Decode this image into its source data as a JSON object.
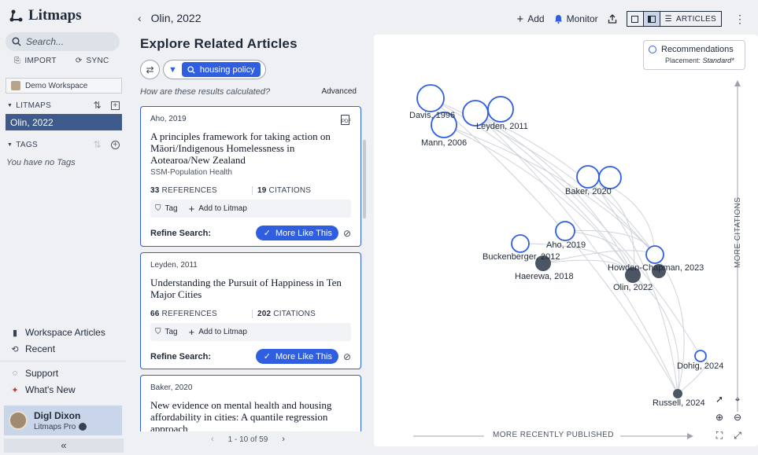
{
  "app": {
    "name": "Litmaps",
    "search_placeholder": "Search...",
    "import_label": "IMPORT",
    "sync_label": "SYNC",
    "workspace": "Demo Workspace",
    "litmaps_header": "LITMAPS",
    "selected_litmap": "Olin, 2022",
    "tags_header": "TAGS",
    "no_tags": "You have no Tags",
    "workspace_articles": "Workspace Articles",
    "recent": "Recent",
    "support": "Support",
    "whats_new": "What's New",
    "user_name": "Digl Dixon",
    "user_plan": "Litmaps Pro"
  },
  "topbar": {
    "title": "Olin, 2022",
    "add": "Add",
    "monitor": "Monitor",
    "articles": "ARTICLES"
  },
  "explore": {
    "title": "Explore Related Articles",
    "filter_chip": "housing policy",
    "how_calculated": "How are these results calculated?",
    "advanced": "Advanced",
    "refine_label": "Refine Search:",
    "more_like_this": "More Like This",
    "tag_label": "Tag",
    "add_to_litmap": "Add to Litmap",
    "references_label": "REFERENCES",
    "citations_label": "CITATIONS",
    "pager": "1 - 10 of 59",
    "pdf_label": "PDF"
  },
  "articles": [
    {
      "meta": "Aho, 2019",
      "title": "A principles framework for taking action on Māori/Indigenous Homelessness in Aotearoa/New Zealand",
      "journal": "SSM-Population Health",
      "references": "33",
      "citations": "19"
    },
    {
      "meta": "Leyden, 2011",
      "title": "Understanding the Pursuit of Happiness in Ten Major Cities",
      "journal": "",
      "references": "66",
      "citations": "202"
    },
    {
      "meta": "Baker, 2020",
      "title": "New evidence on mental health and housing affordability in cities: A quantile regression approach",
      "journal": "",
      "references": "",
      "citations": ""
    }
  ],
  "graph": {
    "recommendations": "Recommendations",
    "placement_label": "Placement:",
    "placement_value": "Standard*",
    "x_axis": "MORE RECENTLY PUBLISHED",
    "y_axis": "MORE CITATIONS",
    "accent": "#2f5fe0",
    "seed_color": "#4b5563",
    "nodes": [
      {
        "label": "Davis, 1996",
        "type": "recommendation"
      },
      {
        "label": "Mann, 2006",
        "type": "recommendation"
      },
      {
        "label": "Leyden, 2011",
        "type": "recommendation"
      },
      {
        "label": "Baker, 2020",
        "type": "recommendation"
      },
      {
        "label": "Aho, 2019",
        "type": "recommendation"
      },
      {
        "label": "Buckenberger, 2012",
        "type": "recommendation"
      },
      {
        "label": "Haerewa, 2018",
        "type": "seed"
      },
      {
        "label": "Olin, 2022",
        "type": "seed"
      },
      {
        "label": "Howden-Chapman, 2023",
        "type": "recommendation"
      },
      {
        "label": "Dohig, 2024",
        "type": "recommendation"
      },
      {
        "label": "Russell, 2024",
        "type": "seed"
      }
    ]
  }
}
